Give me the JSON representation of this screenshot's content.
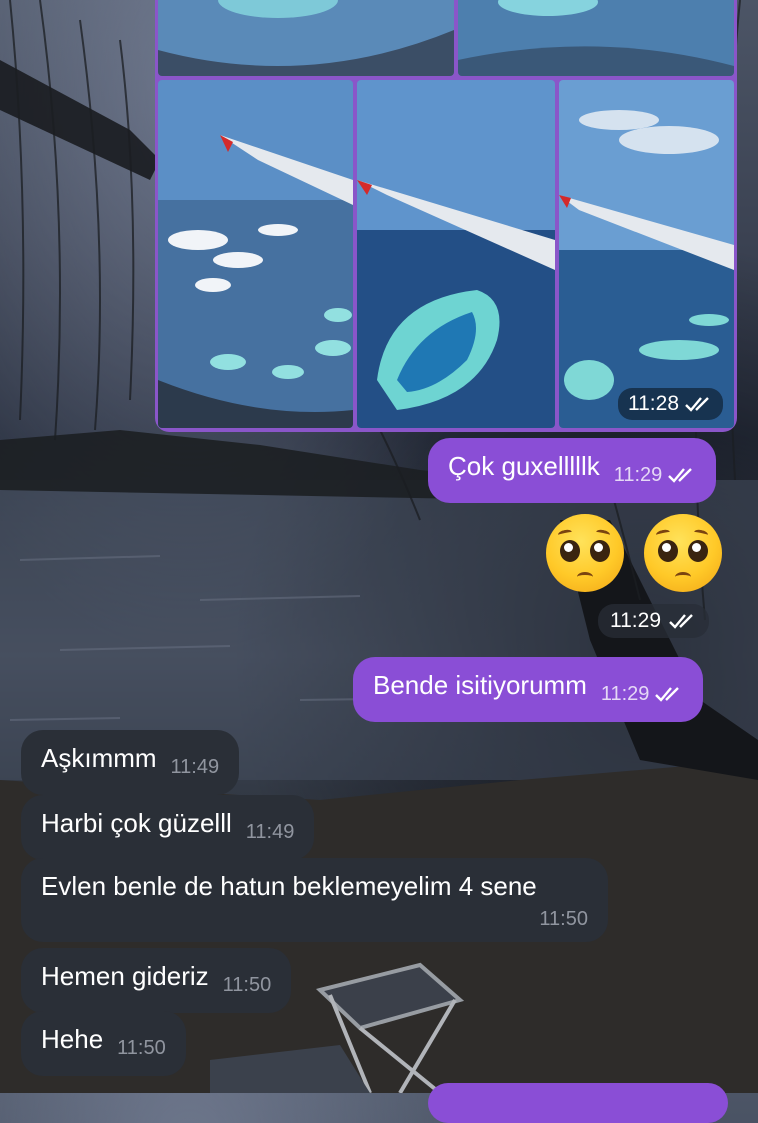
{
  "album": {
    "time": "11:28"
  },
  "messages": [
    {
      "text": "Çok guxelllllk",
      "time": "11:29"
    },
    {
      "text": "Bende isitiyorumm",
      "time": "11:29"
    },
    {
      "text": "Aşkımmm",
      "time": "11:49"
    },
    {
      "text": "Harbi çok güzelll",
      "time": "11:49"
    },
    {
      "text": "Evlen benle de hatun beklemeyelim 4 sene",
      "time": "11:50"
    },
    {
      "text": "Hemen gideriz",
      "time": "11:50"
    },
    {
      "text": "Hehe",
      "time": "11:50"
    }
  ],
  "emoji_message": {
    "emoji": "🥺🥺",
    "time": "11:29"
  },
  "colors": {
    "outgoing": "#8a4ed6",
    "incoming": "#2a2f37"
  }
}
